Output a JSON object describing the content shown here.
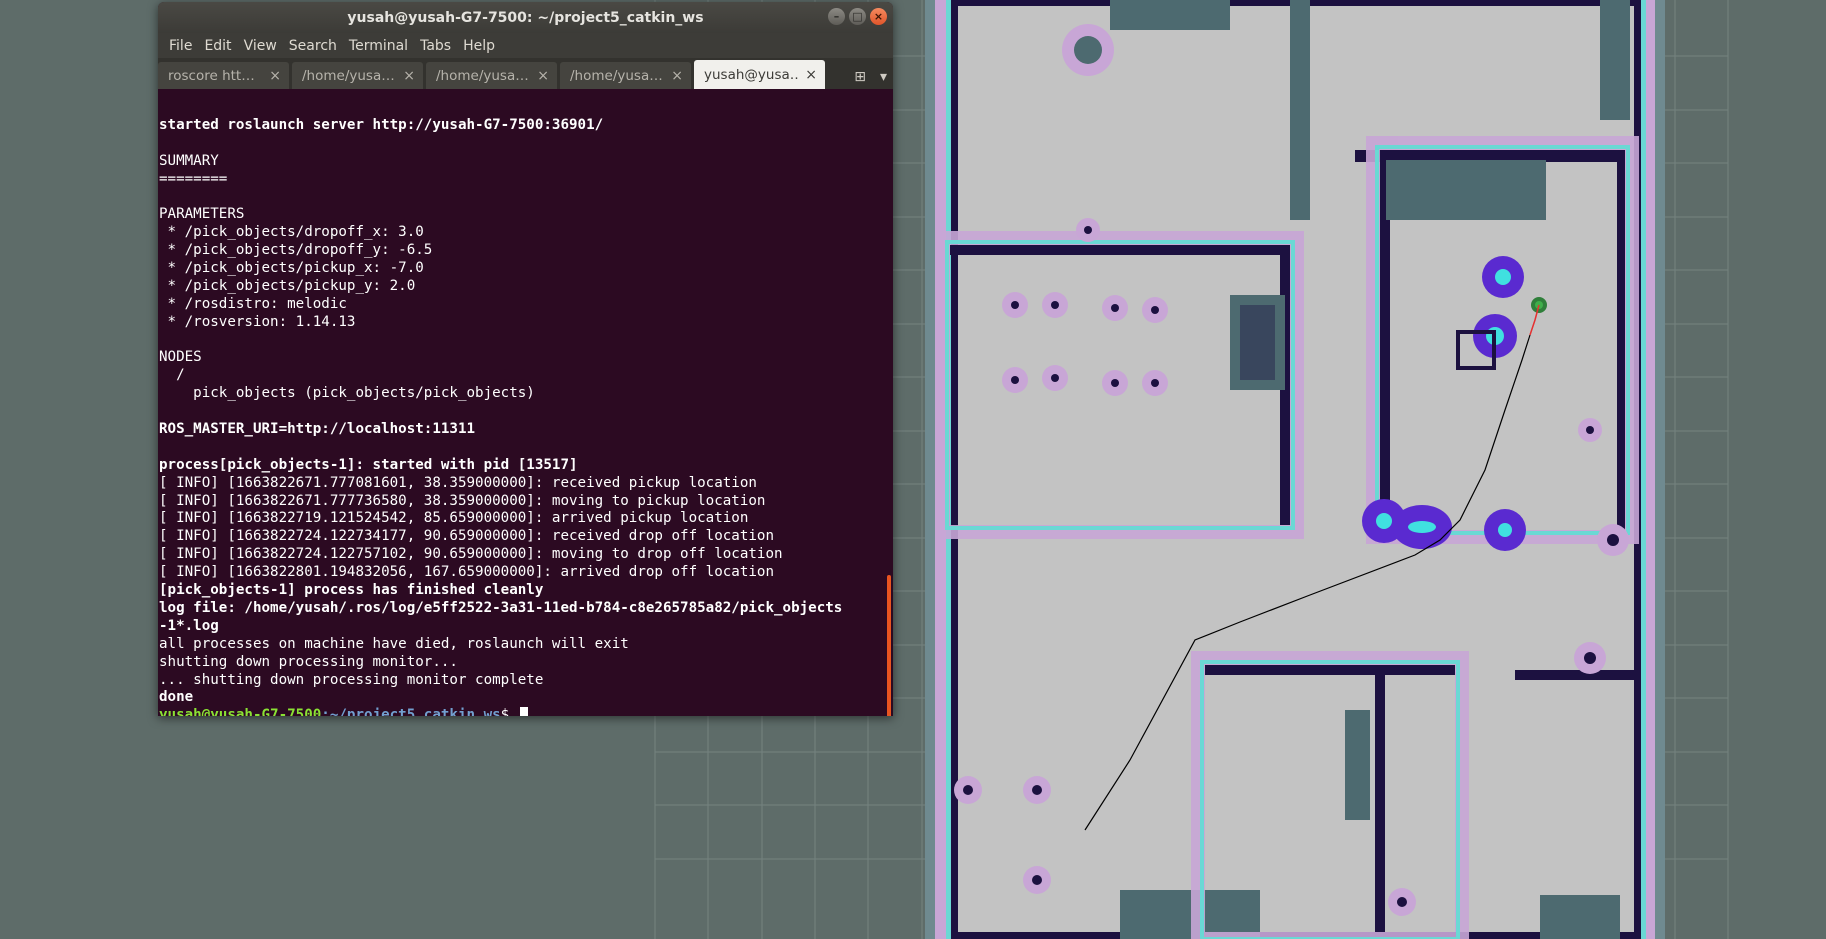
{
  "terminal": {
    "title": "yusah@yusah-G7-7500: ~/project5_catkin_ws",
    "menu": [
      "File",
      "Edit",
      "View",
      "Search",
      "Terminal",
      "Tabs",
      "Help"
    ],
    "tabs": [
      {
        "label": "roscore htt…",
        "active": false
      },
      {
        "label": "/home/yusa…",
        "active": false
      },
      {
        "label": "/home/yusa…",
        "active": false
      },
      {
        "label": "/home/yusa…",
        "active": false
      },
      {
        "label": "yusah@yusa…",
        "active": true
      }
    ],
    "lines": [
      {
        "text": "",
        "style": "normal"
      },
      {
        "text": "started roslaunch server http://yusah-G7-7500:36901/",
        "style": "bold"
      },
      {
        "text": "",
        "style": "normal"
      },
      {
        "text": "SUMMARY",
        "style": "normal"
      },
      {
        "text": "========",
        "style": "normal"
      },
      {
        "text": "",
        "style": "normal"
      },
      {
        "text": "PARAMETERS",
        "style": "normal"
      },
      {
        "text": " * /pick_objects/dropoff_x: 3.0",
        "style": "normal"
      },
      {
        "text": " * /pick_objects/dropoff_y: -6.5",
        "style": "normal"
      },
      {
        "text": " * /pick_objects/pickup_x: -7.0",
        "style": "normal"
      },
      {
        "text": " * /pick_objects/pickup_y: 2.0",
        "style": "normal"
      },
      {
        "text": " * /rosdistro: melodic",
        "style": "normal"
      },
      {
        "text": " * /rosversion: 1.14.13",
        "style": "normal"
      },
      {
        "text": "",
        "style": "normal"
      },
      {
        "text": "NODES",
        "style": "normal"
      },
      {
        "text": "  /",
        "style": "normal"
      },
      {
        "text": "    pick_objects (pick_objects/pick_objects)",
        "style": "normal"
      },
      {
        "text": "",
        "style": "normal"
      },
      {
        "text": "ROS_MASTER_URI=http://localhost:11311",
        "style": "bold"
      },
      {
        "text": "",
        "style": "normal"
      },
      {
        "text": "process[pick_objects-1]: started with pid [13517]",
        "style": "bold"
      },
      {
        "text": "[ INFO] [1663822671.777081601, 38.359000000]: received pickup location",
        "style": "normal"
      },
      {
        "text": "[ INFO] [1663822671.777736580, 38.359000000]: moving to pickup location",
        "style": "normal"
      },
      {
        "text": "[ INFO] [1663822719.121524542, 85.659000000]: arrived pickup location",
        "style": "normal"
      },
      {
        "text": "[ INFO] [1663822724.122734177, 90.659000000]: received drop off location",
        "style": "normal"
      },
      {
        "text": "[ INFO] [1663822724.122757102, 90.659000000]: moving to drop off location",
        "style": "normal"
      },
      {
        "text": "[ INFO] [1663822801.194832056, 167.659000000]: arrived drop off location",
        "style": "normal"
      },
      {
        "text": "[pick_objects-1] process has finished cleanly",
        "style": "bold"
      },
      {
        "text": "log file: /home/yusah/.ros/log/e5ff2522-3a31-11ed-b784-c8e265785a82/pick_objects",
        "style": "bold"
      },
      {
        "text": "-1*.log",
        "style": "bold"
      },
      {
        "text": "all processes on machine have died, roslaunch will exit",
        "style": "normal"
      },
      {
        "text": "shutting down processing monitor...",
        "style": "normal"
      },
      {
        "text": "... shutting down processing monitor complete",
        "style": "normal"
      },
      {
        "text": "done",
        "style": "bold"
      }
    ],
    "prompt": {
      "user_host": "yusah@yusah-G7-7500",
      "path": ":~/project5_catkin_ws",
      "symbol": "$ "
    }
  },
  "colors": {
    "terminal_bg": "#2c0a22",
    "prompt_user": "#8ae234",
    "prompt_path": "#729fcf",
    "scrollbar": "#e95420",
    "map_free": "#c3c3c3",
    "map_unknown": "#5e6c69",
    "inflation": "#c9a4d6",
    "obstacle": "#1c1140",
    "path": "#000000"
  }
}
